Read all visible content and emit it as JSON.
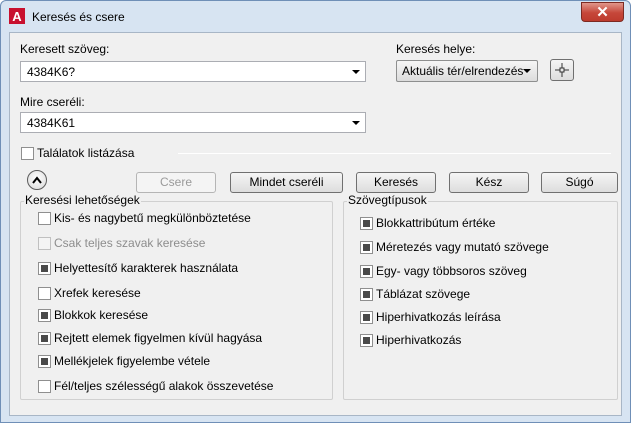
{
  "window": {
    "title": "Keresés és csere",
    "close_glyph": "✕",
    "app_icon_letter": "A"
  },
  "find": {
    "label": "Keresett szöveg:",
    "value": "4384K6?"
  },
  "replace": {
    "label": "Mire cseréli:",
    "value": "4384K61"
  },
  "location": {
    "label": "Keresés helye:",
    "value": "Aktuális tér/elrendezés",
    "pick_icon": "crosshair-select-icon"
  },
  "list_results": {
    "label": "Találatok listázása",
    "checked": false
  },
  "buttons": {
    "replace": "Csere",
    "replace_all": "Mindet cseréli",
    "find": "Keresés",
    "done": "Kész",
    "help": "Súgó"
  },
  "search_options": {
    "title": "Keresési lehetőségek",
    "items": [
      {
        "label": "Kis- és nagybetű megkülönböztetése",
        "checked": false,
        "disabled": false
      },
      {
        "label": "Csak teljes szavak keresése",
        "checked": false,
        "disabled": true
      },
      {
        "label": "Helyettesítő karakterek használata",
        "checked": true,
        "disabled": false
      },
      {
        "label": "Xrefek keresése",
        "checked": false,
        "disabled": false
      },
      {
        "label": "Blokkok keresése",
        "checked": true,
        "disabled": false
      },
      {
        "label": "Rejtett elemek figyelmen kívül hagyása",
        "checked": true,
        "disabled": false
      },
      {
        "label": "Mellékjelek figyelembe vétele",
        "checked": true,
        "disabled": false
      },
      {
        "label": "Fél/teljes szélességű alakok összevetése",
        "checked": false,
        "disabled": false
      }
    ]
  },
  "text_types": {
    "title": "Szövegtípusok",
    "items": [
      {
        "label": "Blokkattribútum értéke",
        "checked": true
      },
      {
        "label": "Méretezés vagy mutató szövege",
        "checked": true
      },
      {
        "label": "Egy- vagy többsoros szöveg",
        "checked": true
      },
      {
        "label": "Táblázat szövege",
        "checked": true
      },
      {
        "label": "Hiperhivatkozás leírása",
        "checked": true
      },
      {
        "label": "Hiperhivatkozás",
        "checked": true
      }
    ]
  }
}
